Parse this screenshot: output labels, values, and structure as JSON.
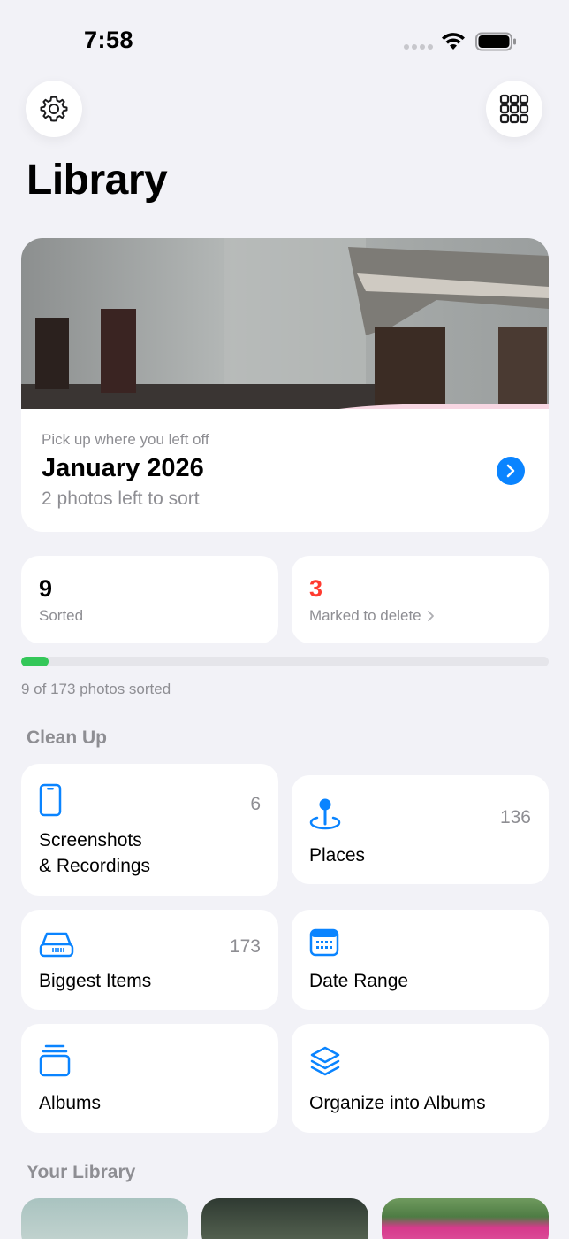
{
  "status_bar": {
    "time": "7:58"
  },
  "header": {
    "title": "Library"
  },
  "resume": {
    "kicker": "Pick up where you left off",
    "title": "January 2026",
    "subtitle": "2 photos left to sort"
  },
  "stats": {
    "sorted_value": "9",
    "sorted_label": "Sorted",
    "delete_value": "3",
    "delete_label": "Marked to delete",
    "delete_color": "#ff3b30"
  },
  "progress": {
    "text": "9 of 173 photos sorted",
    "fraction": 0.052,
    "color": "#34c759"
  },
  "cleanup": {
    "title": "Clean Up",
    "screenshots": {
      "label_line1": "Screenshots",
      "label_line2": "& Recordings",
      "count": "6",
      "icon": "phone-icon"
    },
    "places": {
      "label": "Places",
      "count": "136",
      "icon": "map-pin-icon"
    },
    "biggest": {
      "label": "Biggest Items",
      "count": "173",
      "icon": "hard-drive-icon"
    },
    "date_range": {
      "label": "Date Range",
      "icon": "calendar-icon"
    },
    "albums": {
      "label": "Albums",
      "icon": "albums-icon"
    },
    "organize": {
      "label": "Organize into Albums",
      "icon": "stack-icon"
    }
  },
  "your_library": {
    "title": "Your Library"
  },
  "accent_color": "#0a84ff"
}
